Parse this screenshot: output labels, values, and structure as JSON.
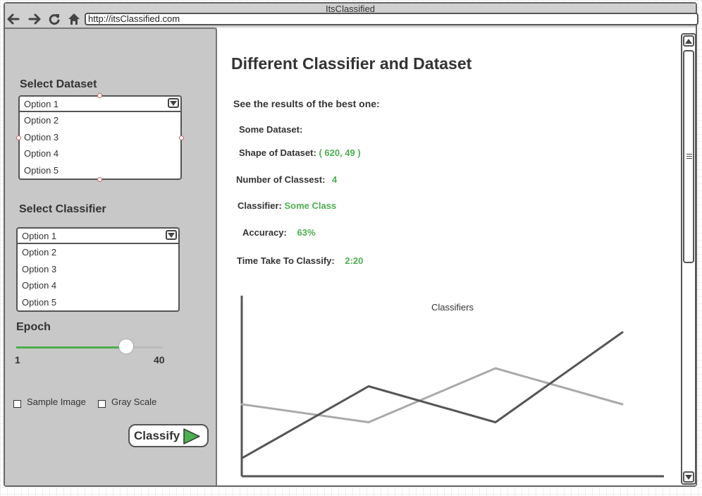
{
  "window": {
    "title": "ItsClassified"
  },
  "browser": {
    "url": "http://itsClassified.com"
  },
  "sidebar": {
    "dataset": {
      "label": "Select Dataset",
      "selected": "Option 1",
      "options": [
        "Option 2",
        "Option 3",
        "Option 4",
        "Option 5"
      ]
    },
    "classifier": {
      "label": "Select Classifier",
      "selected": "Option 1",
      "options": [
        "Option 2",
        "Option 3",
        "Option 4",
        "Option 5"
      ]
    },
    "epoch": {
      "label": "Epoch",
      "min": "1",
      "max": "40",
      "value_fraction": 0.75
    },
    "checkboxes": {
      "sample_image": "Sample Image",
      "gray_scale": "Gray Scale"
    },
    "classify_button": "Classify"
  },
  "main": {
    "title": "Different Classifier and Dataset",
    "subtitle": "See the results of the best one:",
    "dataset_name": "Some Dataset:",
    "shape_label": "Shape of Dataset:",
    "shape_value": "( 620, 49 )",
    "classes_label": "Number of Classest:",
    "classes_value": "4",
    "classifier_label": "Classifier:",
    "classifier_value": "Some Class",
    "accuracy_label": "Accuracy:",
    "accuracy_value": "63%",
    "time_label": "Time Take To Classify:",
    "time_value": "2:20"
  },
  "colors": {
    "accent_green": "#4caf50",
    "dark_line": "#555555",
    "light_line": "#aaaaaa"
  },
  "chart_data": {
    "type": "line",
    "title": "Classifiers",
    "x": [
      1,
      2,
      3,
      4
    ],
    "series": [
      {
        "values": [
          1.0,
          5.0,
          3.0,
          8.0
        ]
      },
      {
        "values": [
          4.0,
          3.0,
          6.0,
          4.0
        ]
      }
    ],
    "ylim": [
      0,
      10
    ],
    "xlabel": "",
    "ylabel": "",
    "grid": false,
    "legend": "none"
  }
}
